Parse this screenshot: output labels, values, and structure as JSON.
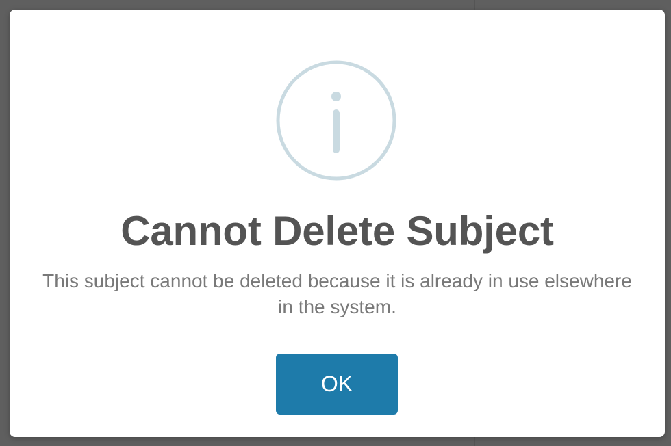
{
  "dialog": {
    "icon": "info-circle-icon",
    "title": "Cannot Delete Subject",
    "message": "This subject cannot be deleted because it is already in use elsewhere in the system.",
    "ok_label": "OK"
  },
  "colors": {
    "backdrop": "#5f5f5f",
    "icon": "#c9dae1",
    "title": "#545454",
    "message": "#797979",
    "button": "#1e7baa",
    "button_text": "#ffffff"
  }
}
